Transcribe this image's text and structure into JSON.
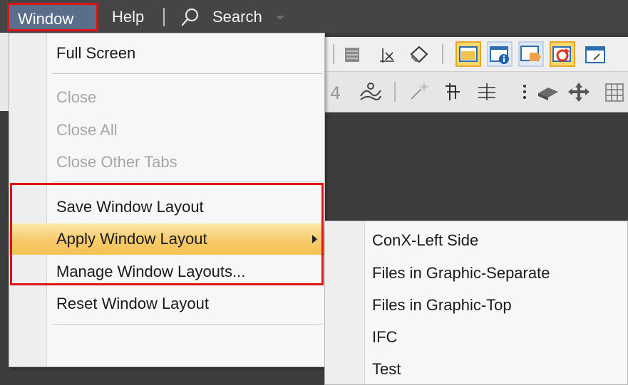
{
  "menubar": {
    "window_label": "Window",
    "help_label": "Help",
    "search_label": "Search"
  },
  "window_menu": {
    "items": [
      {
        "label": "Full Screen",
        "enabled": true
      },
      {
        "label": "Close",
        "enabled": false
      },
      {
        "label": "Close All",
        "enabled": false
      },
      {
        "label": "Close Other Tabs",
        "enabled": false
      },
      {
        "label": "Save Window Layout",
        "enabled": true
      },
      {
        "label": "Apply Window Layout",
        "enabled": true,
        "has_submenu": true,
        "highlighted": true
      },
      {
        "label": "Manage Window Layouts...",
        "enabled": true
      },
      {
        "label": "Reset Window Layout",
        "enabled": true
      }
    ]
  },
  "apply_layout_submenu": {
    "items": [
      {
        "label": "ConX-Left Side"
      },
      {
        "label": "Files in Graphic-Separate"
      },
      {
        "label": "Files in Graphic-Top"
      },
      {
        "label": "IFC"
      },
      {
        "label": "Test"
      }
    ]
  },
  "colors": {
    "highlight_box": "#e01313",
    "menubar_bg": "#454545",
    "hover_gradient": "#f7c96a"
  }
}
